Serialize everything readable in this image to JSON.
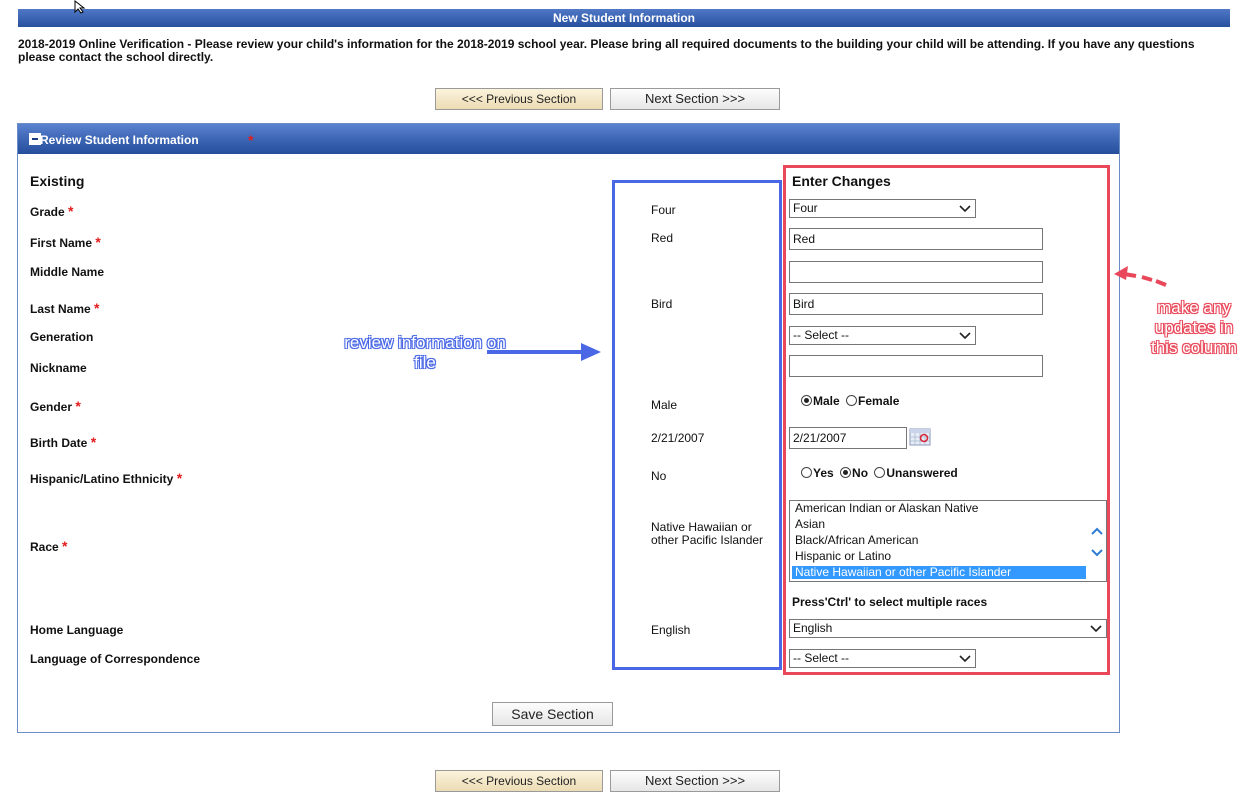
{
  "window": {
    "title": "New Student Information"
  },
  "instructions": "2018-2019 Online Verification - Please review your child's information for the 2018-2019 school year. Please bring all required documents to the building your child will be attending. If you have any questions please contact the school directly.",
  "nav": {
    "prev_label": "<<< Previous Section",
    "next_label": "Next Section >>>"
  },
  "section": {
    "title": "Review Student Information",
    "required_mark": "*",
    "col_existing": "Existing",
    "col_changes": "Enter Changes",
    "save_label": "Save Section"
  },
  "fields": {
    "grade": {
      "label": "Grade",
      "existing": "Four",
      "value": "Four"
    },
    "first_name": {
      "label": "First Name",
      "existing": "Red",
      "value": "Red"
    },
    "middle_name": {
      "label": "Middle Name",
      "existing": "",
      "value": ""
    },
    "last_name": {
      "label": "Last Name",
      "existing": "Bird",
      "value": "Bird"
    },
    "generation": {
      "label": "Generation",
      "existing": "",
      "value": "-- Select --"
    },
    "nickname": {
      "label": "Nickname",
      "existing": "",
      "value": ""
    },
    "gender": {
      "label": "Gender",
      "existing": "Male",
      "options": [
        "Male",
        "Female"
      ],
      "selected": "Male"
    },
    "birth_date": {
      "label": "Birth Date",
      "existing": "2/21/2007",
      "value": "2/21/2007"
    },
    "ethnicity": {
      "label": "Hispanic/Latino Ethnicity",
      "existing": "No",
      "options": [
        "Yes",
        "No",
        "Unanswered"
      ],
      "selected": "No"
    },
    "race": {
      "label": "Race",
      "existing": "Native Hawaiian or other Pacific Islander",
      "options": [
        "American Indian or Alaskan Native",
        "Asian",
        "Black/African American",
        "Hispanic or Latino",
        "Native Hawaiian or other Pacific Islander"
      ],
      "selected": "Native Hawaiian or other Pacific Islander",
      "hint": "Press'Ctrl' to select multiple races"
    },
    "home_language": {
      "label": "Home Language",
      "existing": "English",
      "value": "English"
    },
    "correspondence_language": {
      "label": "Language of Correspondence",
      "existing": "",
      "value": "-- Select --"
    }
  },
  "annotations": {
    "review_note": "review information on file",
    "update_note": "make any updates in this column",
    "review_color": "#4a68e6",
    "update_color": "#e9485a"
  },
  "colors": {
    "header_blue": "#27509f",
    "required_red": "#e21c1c",
    "selection_blue": "#3399ff"
  }
}
